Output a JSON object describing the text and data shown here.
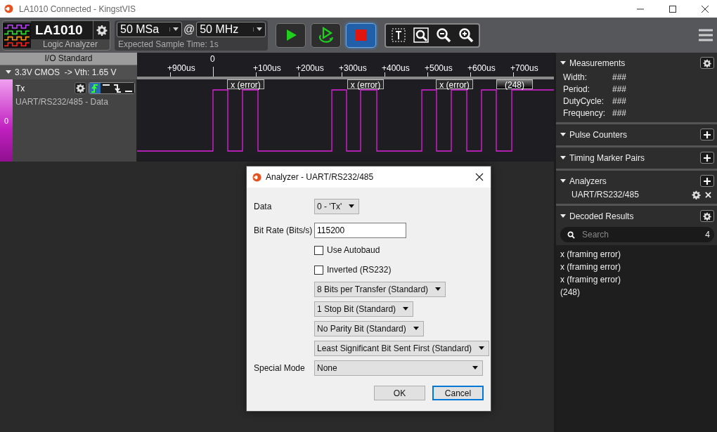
{
  "window": {
    "title": "LA1010 Connected - KingstVIS"
  },
  "device": {
    "name": "LA1010",
    "subtitle": "Logic Analyzer"
  },
  "sample_depth": {
    "value": "50 MSa"
  },
  "at_sign": "@",
  "sample_rate": {
    "value": "50 MHz"
  },
  "expected_time": "Expected Sample Time: 1s",
  "run_buttons": [
    {
      "kind": "start",
      "active": false
    },
    {
      "kind": "loop",
      "active": false
    },
    {
      "kind": "stop",
      "active": true
    }
  ],
  "view_tools": [
    {
      "kind": "text-select"
    },
    {
      "kind": "zoom-fit"
    },
    {
      "kind": "zoom-out"
    },
    {
      "kind": "zoom-in"
    }
  ],
  "io_standard": {
    "title": "I/O Standard",
    "value": "3.3V CMOS",
    "vth": "-> Vth: 1.65 V"
  },
  "ruler": {
    "ticks": [
      {
        "label": "+900us",
        "kind": "minor"
      },
      {
        "label": "0",
        "kind": "origin"
      },
      {
        "label": "+100us",
        "kind": "minor"
      },
      {
        "label": "+200us",
        "kind": "minor"
      },
      {
        "label": "+300us",
        "kind": "minor"
      },
      {
        "label": "+400us",
        "kind": "minor"
      },
      {
        "label": "+500us",
        "kind": "minor"
      },
      {
        "label": "+600us",
        "kind": "minor"
      },
      {
        "label": "+700us",
        "kind": "minor"
      }
    ]
  },
  "channel": {
    "index": "0",
    "name": "Tx",
    "protocol": "UART/RS232/485 - Data",
    "triggers": [
      {
        "kind": "rising",
        "selected": true
      },
      {
        "kind": "high",
        "selected": false
      },
      {
        "kind": "falling",
        "selected": false
      },
      {
        "kind": "low",
        "selected": false
      }
    ],
    "decoded_labels": [
      {
        "text": "x (error)",
        "kind": "error"
      },
      {
        "text": "x (error)",
        "kind": "error"
      },
      {
        "text": "x (error)",
        "kind": "error"
      },
      {
        "text": "(248)",
        "kind": "value"
      }
    ]
  },
  "side_panel": {
    "measurements": {
      "title": "Measurements",
      "rows": [
        {
          "label": "Width:",
          "value": "###"
        },
        {
          "label": "Period:",
          "value": "###"
        },
        {
          "label": "DutyCycle:",
          "value": "###"
        },
        {
          "label": "Frequency:",
          "value": "###"
        }
      ]
    },
    "pulse_counters": {
      "title": "Pulse Counters"
    },
    "timing_marker_pairs": {
      "title": "Timing Marker Pairs"
    },
    "analyzers": {
      "title": "Analyzers",
      "items": [
        {
          "name": "UART/RS232/485"
        }
      ]
    },
    "decoded_results": {
      "title": "Decoded Results",
      "search": {
        "placeholder": "Search"
      },
      "count": "4",
      "results": [
        "x (framing error)",
        "x (framing error)",
        "x (framing error)",
        "(248)"
      ]
    }
  },
  "dialog": {
    "title": "Analyzer - UART/RS232/485",
    "data": {
      "label": "Data",
      "value": "0 - 'Tx'"
    },
    "bit_rate": {
      "label": "Bit Rate (Bits/s)",
      "value": "115200"
    },
    "checkboxes": [
      {
        "label": "Use Autobaud",
        "checked": false
      },
      {
        "label": "Inverted (RS232)",
        "checked": false
      }
    ],
    "dropdowns": [
      "8 Bits per Transfer (Standard)",
      "1 Stop Bit (Standard)",
      "No Parity Bit (Standard)",
      "Least Significant Bit Sent First (Standard)"
    ],
    "special_mode": {
      "label": "Special Mode",
      "value": "None"
    },
    "buttons": [
      {
        "label": "OK",
        "focused": false
      },
      {
        "label": "Cancel",
        "focused": true
      }
    ]
  }
}
